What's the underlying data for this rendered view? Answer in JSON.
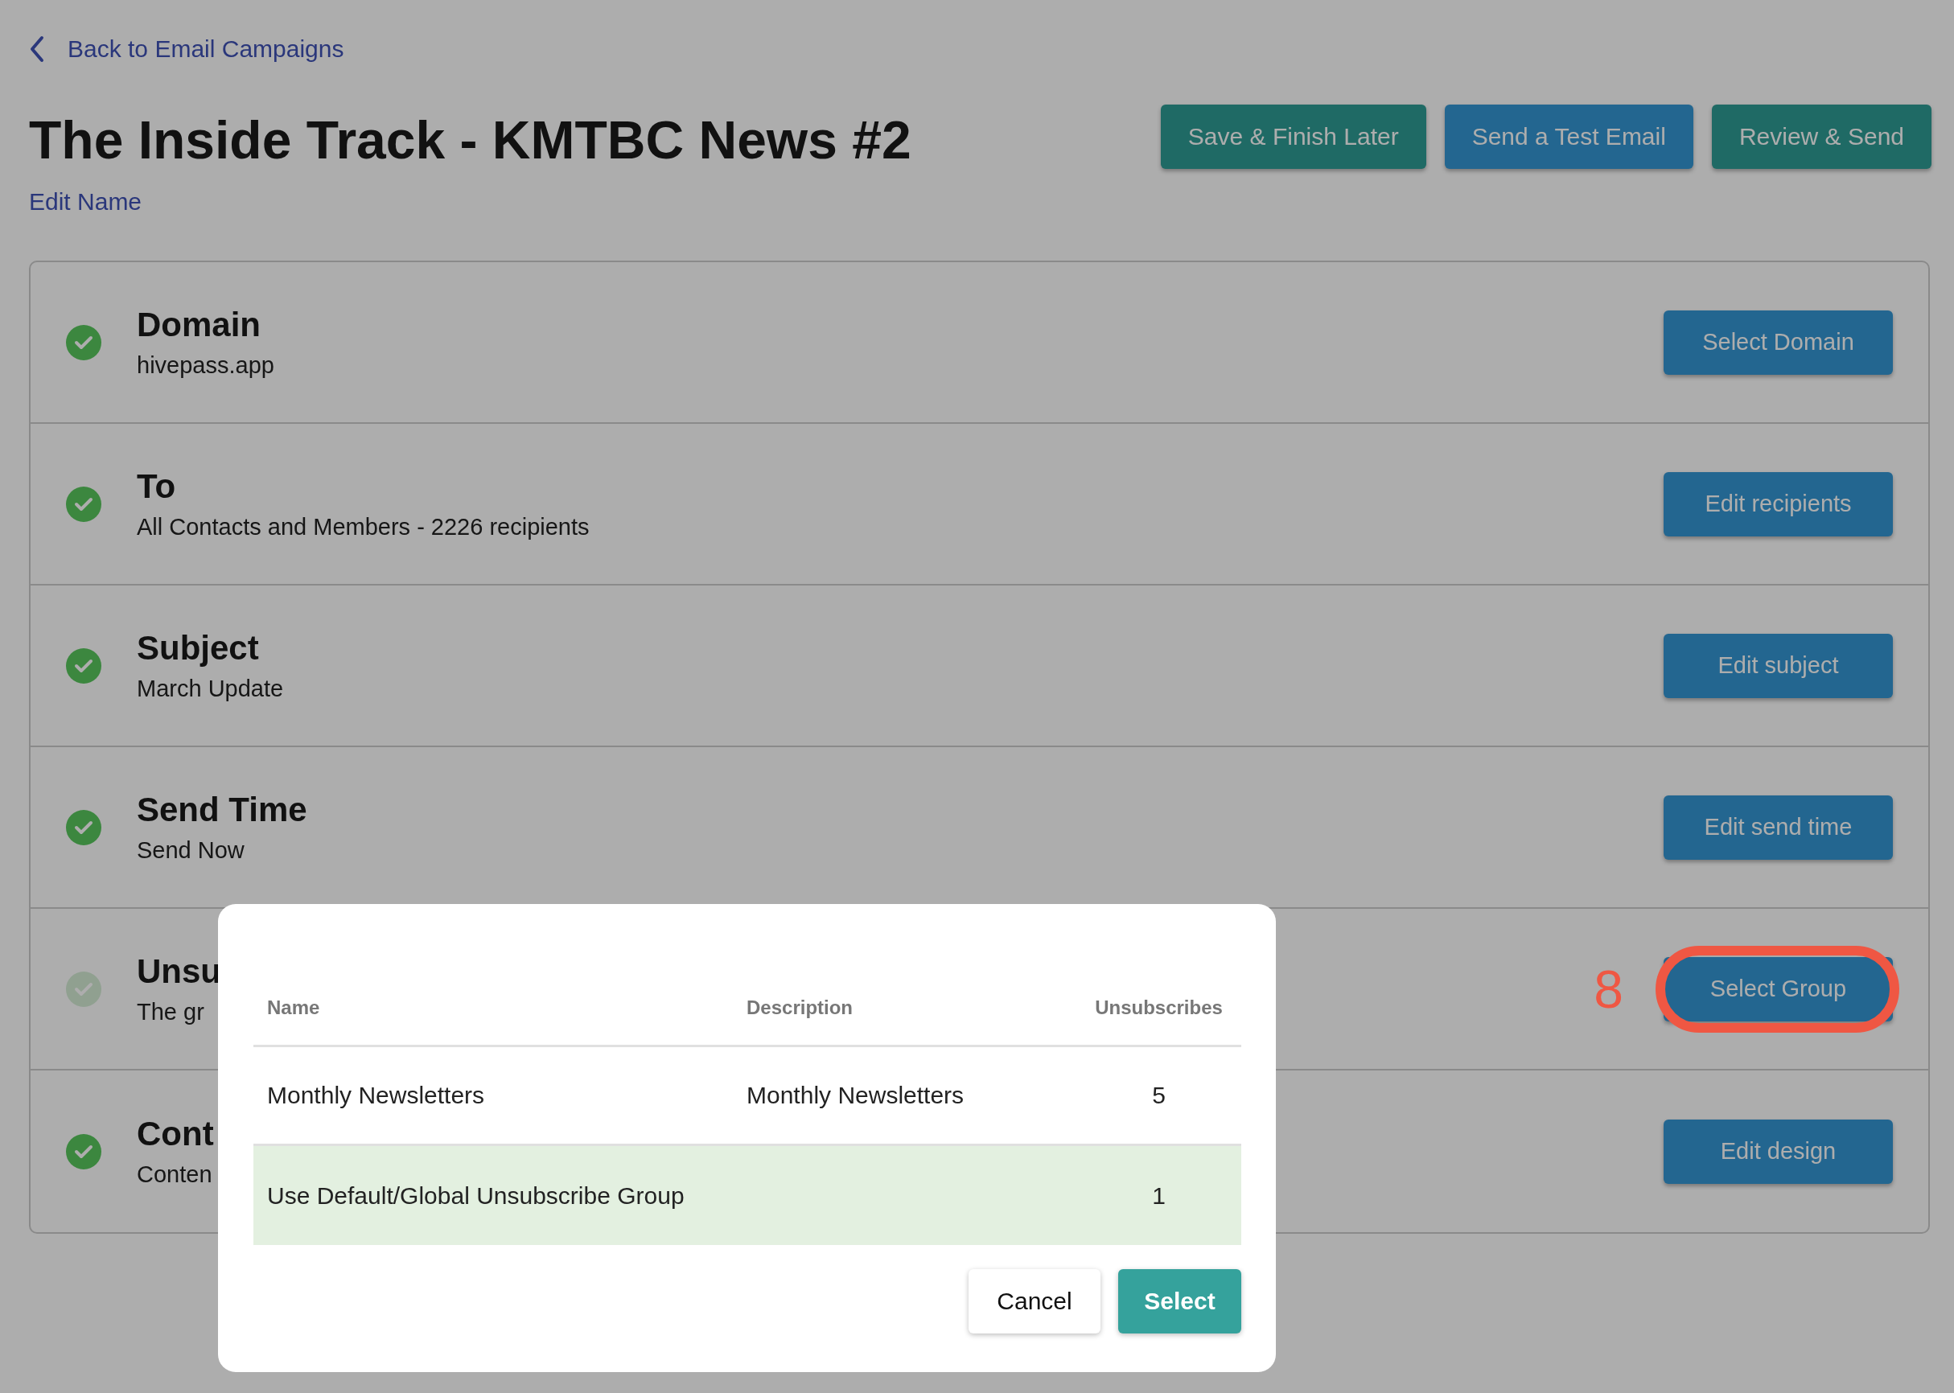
{
  "back_link": {
    "label": "Back to Email Campaigns"
  },
  "title": "The Inside Track - KMTBC News #2",
  "edit_name_link": "Edit Name",
  "header_buttons": [
    {
      "label": "Save & Finish Later",
      "kind": "save"
    },
    {
      "label": "Send a Test Email",
      "kind": "test"
    },
    {
      "label": "Review & Send",
      "kind": "save"
    }
  ],
  "steps": [
    {
      "title": "Domain",
      "detail": "hivepass.app",
      "complete": true,
      "button": "Select Domain"
    },
    {
      "title": "To",
      "detail": "All Contacts and Members - 2226 recipients",
      "complete": true,
      "button": "Edit recipients"
    },
    {
      "title": "Subject",
      "detail": "March Update",
      "complete": true,
      "button": "Edit subject"
    },
    {
      "title": "Send Time",
      "detail": "Send Now",
      "complete": true,
      "button": "Edit send time"
    },
    {
      "title": "Unsu",
      "detail": "The gr",
      "complete": false,
      "button": "Select Group",
      "annotation": "8"
    },
    {
      "title": "Cont",
      "detail": "Conten",
      "complete": true,
      "button": "Edit design"
    }
  ],
  "dialog": {
    "columns": [
      "Name",
      "Description",
      "Unsubscribes"
    ],
    "rows": [
      {
        "name": "Monthly Newsletters",
        "description": "Monthly Newsletters",
        "unsubscribes": "5",
        "selected": false
      },
      {
        "name": "Use Default/Global Unsubscribe Group",
        "unsubscribes": "1",
        "selected": true
      }
    ],
    "buttons": [
      {
        "label": "Cancel",
        "kind": "secondary"
      },
      {
        "label": "Select",
        "kind": "primary"
      }
    ]
  }
}
